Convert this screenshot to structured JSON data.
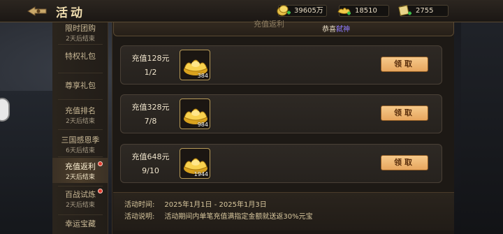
{
  "header": {
    "title": "活动",
    "resources": [
      {
        "icon": "gold-coin-icon",
        "value": "39605万"
      },
      {
        "icon": "gold-ingot-icon",
        "value": "18510"
      },
      {
        "icon": "ticket-icon",
        "value": "2755"
      }
    ]
  },
  "sidebar": {
    "items": [
      {
        "label": "限时团购",
        "sub": "2天后结束",
        "dot": false,
        "active": false
      },
      {
        "label": "特权礼包",
        "sub": "",
        "dot": false,
        "active": false
      },
      {
        "label": "尊享礼包",
        "sub": "",
        "dot": false,
        "active": false
      },
      {
        "label": "充值排名",
        "sub": "2天后结束",
        "dot": false,
        "active": false
      },
      {
        "label": "三国感恩季",
        "sub": "6天后结束",
        "dot": false,
        "active": false
      },
      {
        "label": "充值返利",
        "sub": "2天后结束",
        "dot": true,
        "active": true
      },
      {
        "label": "百战试炼",
        "sub": "2天后结束",
        "dot": true,
        "active": false
      },
      {
        "label": "幸运宝藏",
        "sub": "",
        "dot": false,
        "active": false
      }
    ]
  },
  "banner": {
    "title": "充值返利",
    "marquee_prefix": "恭喜",
    "marquee_name": "弑神"
  },
  "rewards": [
    {
      "label": "充值128元",
      "progress": "1/2",
      "item_count": "384",
      "button": "领取"
    },
    {
      "label": "充值328元",
      "progress": "7/8",
      "item_count": "984",
      "button": "领取"
    },
    {
      "label": "充值648元",
      "progress": "9/10",
      "item_count": "1944",
      "button": "领取"
    }
  ],
  "footer": {
    "time_label": "活动时间:",
    "time_value": "2025年1月1日 - 2025年1月3日",
    "desc_label": "活动说明:",
    "desc_value": "活动期间内单笔充值满指定金额就送返30%元宝"
  },
  "colors": {
    "accent": "#e7a65e",
    "highlight_name": "#8f7cff",
    "red_dot": "#e23b2e"
  }
}
